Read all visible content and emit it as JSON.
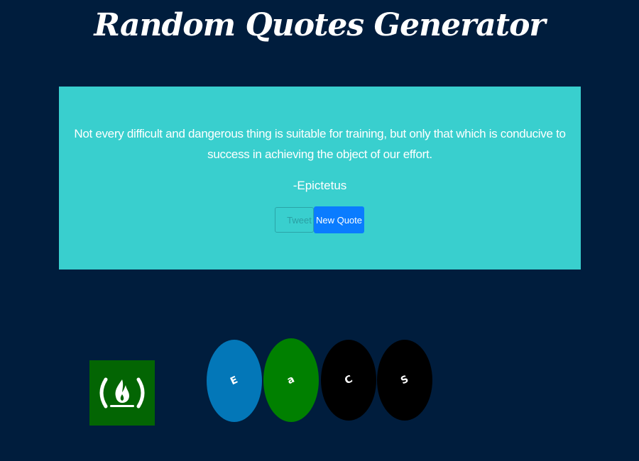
{
  "header": {
    "title": "Random Quotes Generator"
  },
  "quote": {
    "text": "Not every difficult and dangerous thing is suitable for training, but only that which is conducive to success in achieving the object of our effort.",
    "author": "-Epictetus"
  },
  "buttons": {
    "tweet_label": "Tweet",
    "new_quote_label": "New Quote"
  },
  "footer": {
    "logo_icon": "freecodecamp-flame-icon",
    "social_links": [
      {
        "icon": "e-icon",
        "glyph": "E",
        "color": "#0377b8"
      },
      {
        "icon": "a-icon",
        "glyph": "a",
        "color": "#008000"
      },
      {
        "icon": "c-icon",
        "glyph": "C",
        "color": "#000000"
      },
      {
        "icon": "s-icon",
        "glyph": "S",
        "color": "#000000"
      }
    ]
  },
  "colors": {
    "background": "#001d3d",
    "quote_box": "#39cfce",
    "primary_button": "#0a7cff",
    "fcc_green": "#036503"
  }
}
